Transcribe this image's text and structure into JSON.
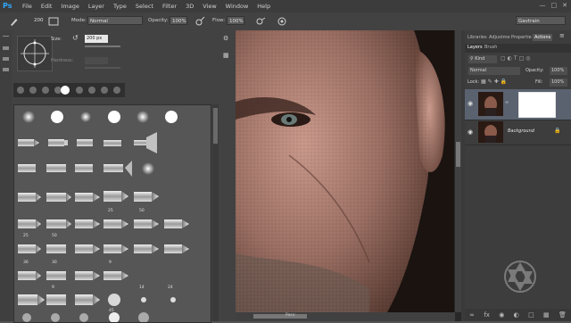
{
  "app": {
    "logo": "Ps"
  },
  "menu": [
    "File",
    "Edit",
    "Image",
    "Layer",
    "Type",
    "Select",
    "Filter",
    "3D",
    "View",
    "Window",
    "Help"
  ],
  "options_bar": {
    "brush_size": "200",
    "mode_label": "Mode:",
    "mode_value": "Normal",
    "opacity_label": "Opacity:",
    "opacity_value": "100%",
    "flow_label": "Flow:",
    "flow_value": "100%",
    "workspace": "Gavtrain"
  },
  "brush_panel": {
    "size_label": "Size:",
    "size_value": "200 px",
    "hardness_label": "Hardness:",
    "grid_numbers": [
      "25",
      "50",
      "25",
      "50",
      "36",
      "30",
      "9",
      "9",
      "14",
      "24",
      "45"
    ]
  },
  "canvas": {
    "scroll_label": "Pass:"
  },
  "layers_panel": {
    "tabs": [
      "Libraries",
      "Adjustme",
      "Propertie",
      "Actions"
    ],
    "subtabs": [
      "Layers",
      "Brush"
    ],
    "kind_label": "Kind",
    "blend_mode": "Normal",
    "opacity_label": "Opacity:",
    "opacity_value": "100%",
    "lock_label": "Lock:",
    "fill_label": "Fill:",
    "fill_value": "100%",
    "layers": [
      {
        "name": ""
      },
      {
        "name": "Background"
      }
    ]
  }
}
